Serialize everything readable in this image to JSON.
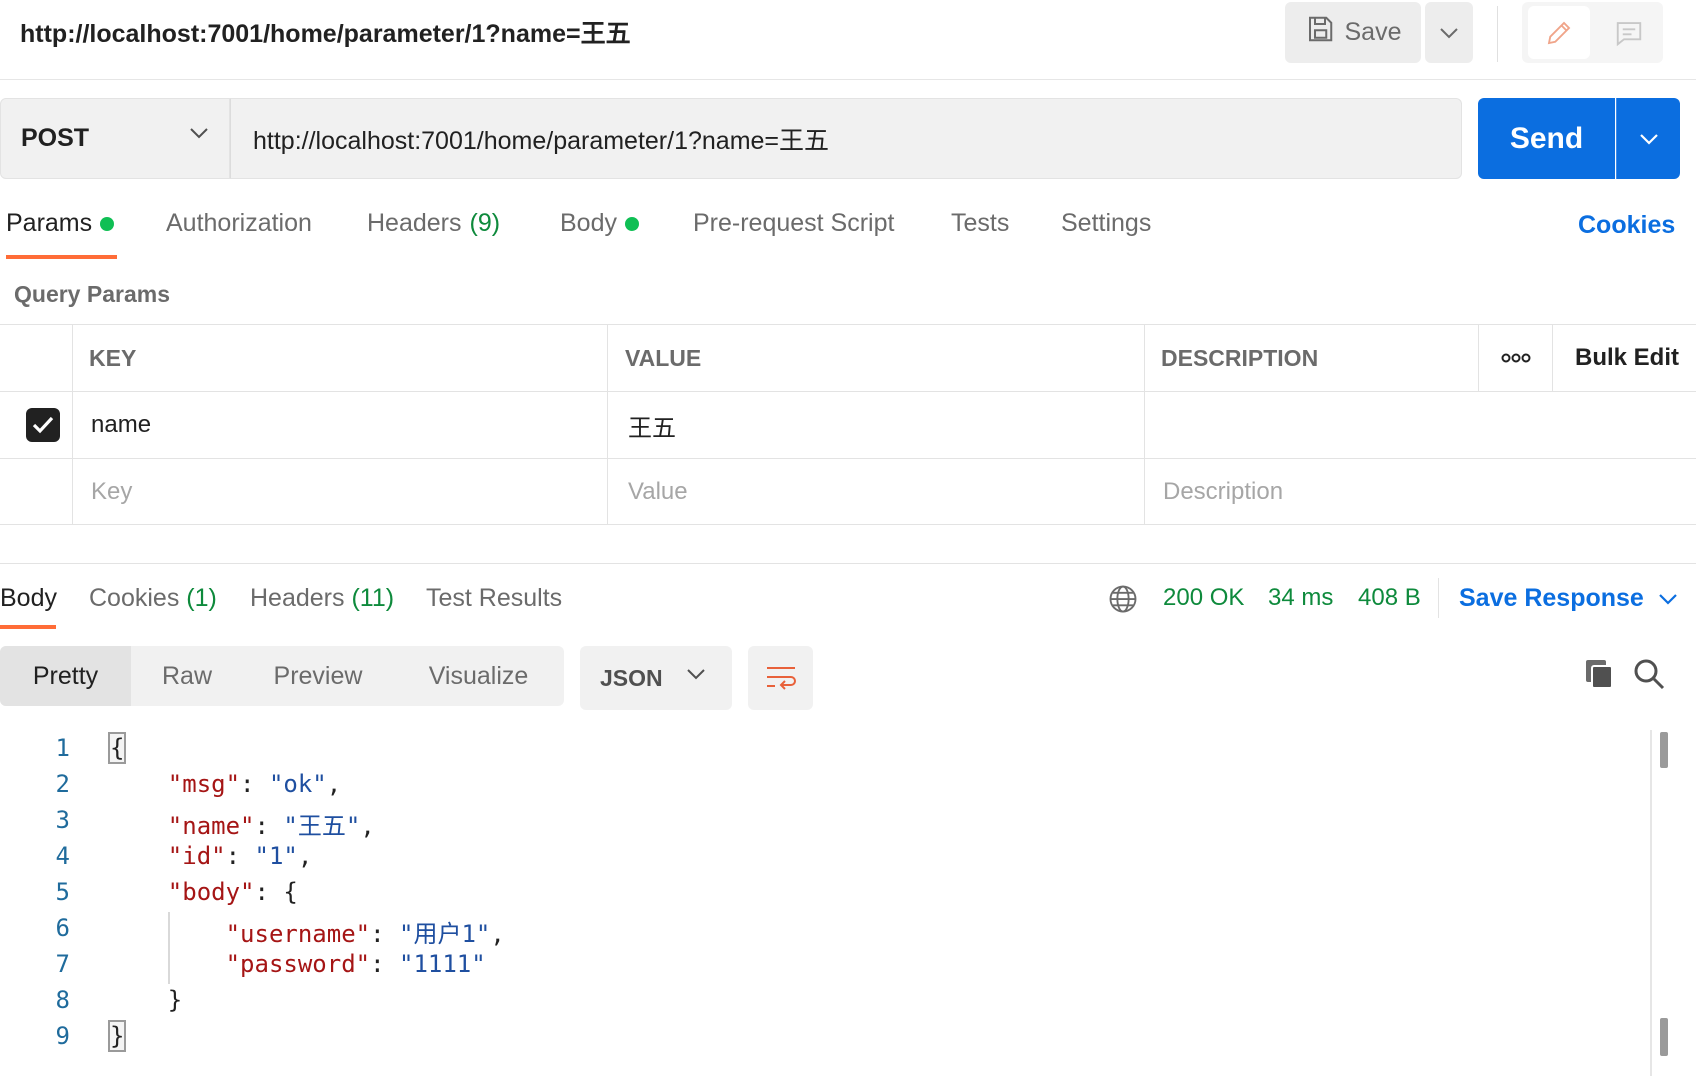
{
  "header": {
    "request_title": "http://localhost:7001/home/parameter/1?name=王五",
    "save_label": "Save"
  },
  "request": {
    "method": "POST",
    "url": "http://localhost:7001/home/parameter/1?name=王五",
    "send_label": "Send"
  },
  "request_tabs": {
    "params": "Params",
    "authorization": "Authorization",
    "headers": "Headers",
    "headers_count": "(9)",
    "body": "Body",
    "pre_request": "Pre-request Script",
    "tests": "Tests",
    "settings": "Settings",
    "cookies": "Cookies"
  },
  "query_params": {
    "label": "Query Params",
    "columns": {
      "key": "KEY",
      "value": "VALUE",
      "description": "DESCRIPTION",
      "bulk_edit": "Bulk Edit"
    },
    "rows": [
      {
        "checked": true,
        "key": "name",
        "value": "王五",
        "description": ""
      }
    ],
    "placeholders": {
      "key": "Key",
      "value": "Value",
      "description": "Description"
    }
  },
  "response": {
    "tabs": {
      "body": "Body",
      "cookies": "Cookies",
      "cookies_count": "(1)",
      "headers": "Headers",
      "headers_count": "(11)",
      "test_results": "Test Results"
    },
    "status": "200 OK",
    "time": "34 ms",
    "size": "408 B",
    "save_response": "Save Response",
    "views": {
      "pretty": "Pretty",
      "raw": "Raw",
      "preview": "Preview",
      "visualize": "Visualize"
    },
    "format": "JSON",
    "colors": {
      "key": "#a51515",
      "string": "#1f4fa0",
      "status": "#0e8a3c",
      "accent": "#0b6ee0",
      "tab_underline": "#ff6c37"
    },
    "code": {
      "line_numbers": [
        "1",
        "2",
        "3",
        "4",
        "5",
        "6",
        "7",
        "8",
        "9"
      ],
      "open_brace": "{",
      "close_brace": "}",
      "msg_key": "\"msg\"",
      "msg_val": "\"ok\"",
      "name_key": "\"name\"",
      "name_val": "\"王五\"",
      "id_key": "\"id\"",
      "id_val": "\"1\"",
      "body_key": "\"body\"",
      "username_key": "\"username\"",
      "username_val": "\"用户1\"",
      "password_key": "\"password\"",
      "password_val": "\"1111\""
    }
  },
  "icons": [
    "save-icon",
    "chevron-down-icon",
    "edit-icon",
    "comment-icon",
    "checkmark-icon",
    "more-icon",
    "globe-icon",
    "wrap-lines-icon",
    "copy-icon",
    "search-icon"
  ]
}
